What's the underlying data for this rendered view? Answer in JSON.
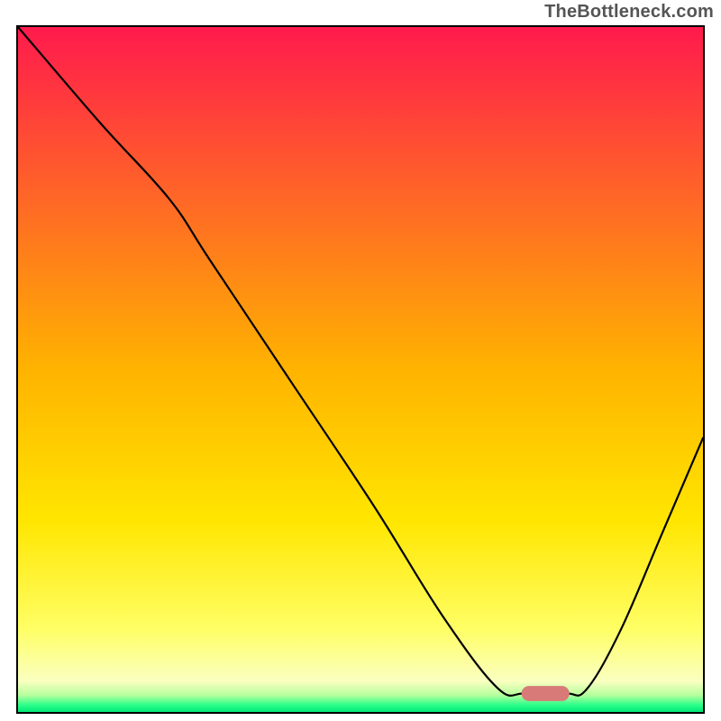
{
  "watermark": "TheBottleneck.com",
  "chart_data": {
    "type": "line",
    "title": "",
    "xlabel": "",
    "ylabel": "",
    "xlim": [
      0,
      100
    ],
    "ylim": [
      0,
      100
    ],
    "grid": false,
    "legend": false,
    "background_gradient_stops": [
      {
        "offset": 0.0,
        "color": "#ff1a4d"
      },
      {
        "offset": 0.5,
        "color": "#ffb300"
      },
      {
        "offset": 0.72,
        "color": "#ffe600"
      },
      {
        "offset": 0.88,
        "color": "#ffff66"
      },
      {
        "offset": 0.955,
        "color": "#faffc0"
      },
      {
        "offset": 0.975,
        "color": "#b8ff9e"
      },
      {
        "offset": 0.99,
        "color": "#2bff8a"
      },
      {
        "offset": 1.0,
        "color": "#00e676"
      }
    ],
    "series": [
      {
        "name": "curve",
        "stroke": "#000000",
        "stroke_width": 2.2,
        "points": [
          {
            "x": 0.0,
            "y": 100.0
          },
          {
            "x": 12.0,
            "y": 86.0
          },
          {
            "x": 22.0,
            "y": 75.0
          },
          {
            "x": 28.0,
            "y": 66.0
          },
          {
            "x": 40.0,
            "y": 48.0
          },
          {
            "x": 52.0,
            "y": 30.0
          },
          {
            "x": 62.0,
            "y": 14.0
          },
          {
            "x": 70.0,
            "y": 3.5
          },
          {
            "x": 74.0,
            "y": 2.7
          },
          {
            "x": 80.0,
            "y": 2.7
          },
          {
            "x": 83.0,
            "y": 3.3
          },
          {
            "x": 88.0,
            "y": 12.0
          },
          {
            "x": 94.0,
            "y": 26.0
          },
          {
            "x": 100.0,
            "y": 40.0
          }
        ]
      }
    ],
    "marker": {
      "shape": "rounded-rect",
      "fill": "#d87a78",
      "cx": 77.0,
      "cy": 2.7,
      "w": 7.0,
      "h": 2.2,
      "rx": 1.1
    }
  }
}
